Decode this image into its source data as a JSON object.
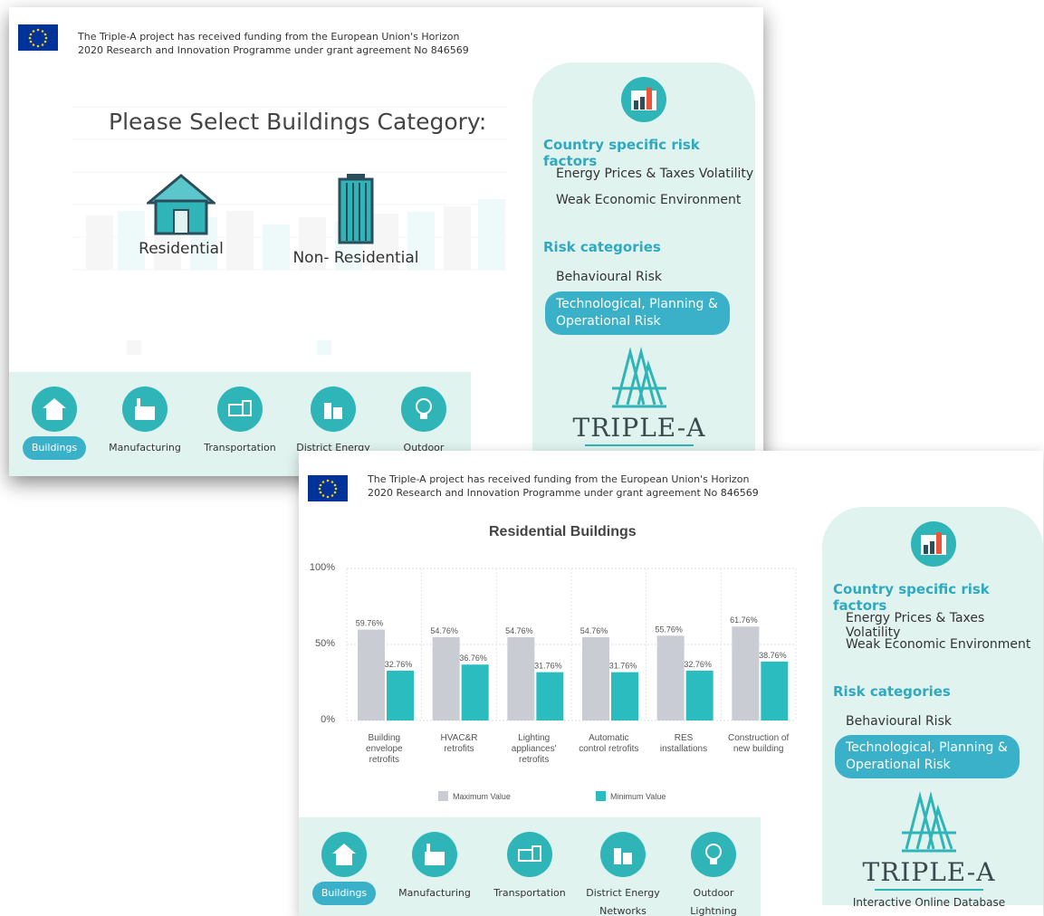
{
  "funding_text_line1": "The Triple-A project has received funding from the European Union's Horizon",
  "funding_text_line2": "2020 Research and Innovation Programme under grant agreement No 846569",
  "panel1": {
    "prompt": "Please Select Buildings Category:",
    "categories": [
      {
        "label": "Residential",
        "icon": "house-icon"
      },
      {
        "label": "Non- Residential",
        "icon": "office-building-icon"
      }
    ]
  },
  "right_panel": {
    "risk_factors_heading": "Country specific risk factors",
    "risk_factors": [
      "Energy Prices & Taxes Volatility",
      "Weak Economic Environment"
    ],
    "risk_categories_heading": "Risk categories",
    "risk_categories": [
      "Behavioural Risk",
      "Technological, Planning &",
      "Operational Risk"
    ],
    "logo_name": "TRIPLE-A",
    "logo_sub": "Interactive Online Database"
  },
  "nav": [
    {
      "label": "Buildings",
      "icon": "buildings-icon",
      "active": true
    },
    {
      "label": "Manufacturing",
      "icon": "factory-icon",
      "active": false
    },
    {
      "label": "Transportation",
      "icon": "truck-icon",
      "active": false
    },
    {
      "label": "District Energy",
      "label2": "Networks",
      "icon": "district-network-icon",
      "active": false
    },
    {
      "label": "Outdoor",
      "label2": "Lightning",
      "icon": "lightbulb-icon",
      "active": false
    }
  ],
  "colors": {
    "teal": "#2fb5b8",
    "pill": "#3ab1c8",
    "panel_bg": "#e1f3ef",
    "max_bar": "#c9ccd3",
    "min_bar": "#2bbcc0"
  },
  "chart_data": {
    "type": "bar",
    "title": "Residential Buildings",
    "categories": [
      "Building envelope retrofits",
      "HVAC&R retrofits",
      "Lighting appliances' retrofits",
      "Automatic control retrofits",
      "RES installations",
      "Construction of new building"
    ],
    "series": [
      {
        "name": "Maximum Value",
        "values": [
          59.76,
          54.76,
          54.76,
          54.76,
          55.76,
          61.76
        ],
        "labels": [
          "59.76%",
          "54.76%",
          "54.76%",
          "54.76%",
          "55.76%",
          "61.76%"
        ]
      },
      {
        "name": "Minimum Value",
        "values": [
          32.76,
          36.76,
          31.76,
          31.76,
          32.76,
          38.76
        ],
        "labels": [
          "32.76%",
          "36.76%",
          "31.76%",
          "31.76%",
          "32.76%",
          "38.76%"
        ]
      }
    ],
    "yticks": [
      "100%",
      "50%",
      "0%"
    ],
    "ylim": [
      0,
      100
    ],
    "legend": "bottom"
  }
}
